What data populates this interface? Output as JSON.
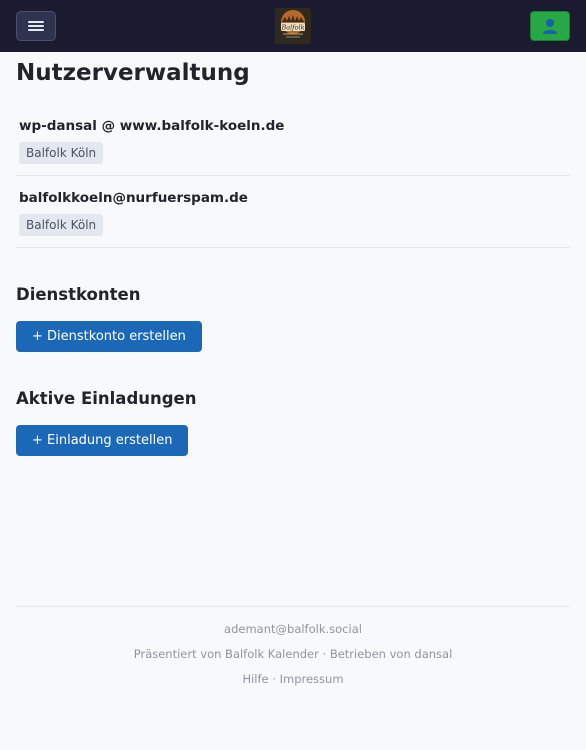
{
  "header": {
    "menu_icon": "hamburger-icon",
    "logo_alt": "Balfolk",
    "user_icon": "user-icon"
  },
  "page": {
    "title": "Nutzerverwaltung"
  },
  "users": [
    {
      "email": "wp-dansal @ www.balfolk-koeln.de",
      "badge": "Balfolk Köln"
    },
    {
      "email": "balfolkkoeln@nurfuerspam.de",
      "badge": "Balfolk Köln"
    }
  ],
  "service_accounts": {
    "heading": "Dienstkonten",
    "button": "+ Dienstkonto erstellen"
  },
  "invitations": {
    "heading": "Aktive Einladungen",
    "button": "+ Einladung erstellen"
  },
  "footer": {
    "account": "ademant@balfolk.social",
    "presented_by": "Präsentiert von Balfolk Kalender",
    "separator": " · ",
    "operated_by": "Betrieben von dansal",
    "help": "Hilfe",
    "imprint": "Impressum"
  },
  "colors": {
    "topbar": "#1a1b2e",
    "primary_button": "#1b69b6",
    "user_button": "#27a844",
    "badge_bg": "#e3e8f0"
  }
}
